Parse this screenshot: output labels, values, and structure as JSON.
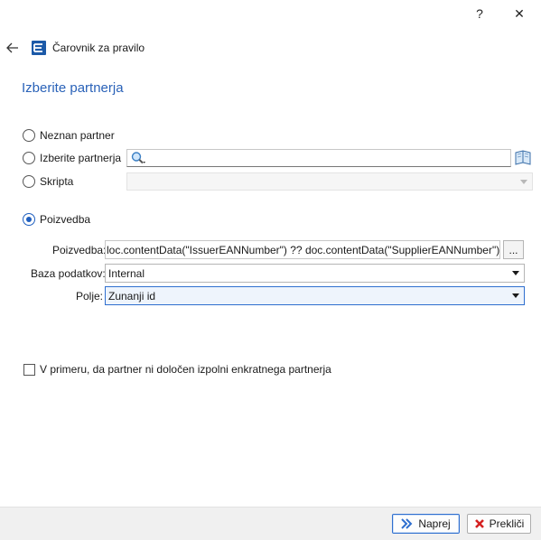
{
  "window": {
    "help_label": "?",
    "close_label": "✕",
    "app_title": "Čarovnik za pravilo",
    "back_icon": "arrow-left-icon",
    "app_icon": "app-logo-icon"
  },
  "page": {
    "title": "Izberite partnerja"
  },
  "options": {
    "unknown_partner": {
      "label": "Neznan partner",
      "checked": false
    },
    "select_partner": {
      "label": "Izberite partnerja",
      "checked": false
    },
    "script": {
      "label": "Skripta",
      "checked": false
    },
    "query": {
      "label": "Poizvedba",
      "checked": true
    }
  },
  "select_partner_field": {
    "value": "",
    "search_icon": "magnifier-icon",
    "browse_icon": "book-icon"
  },
  "script_field": {
    "value": ""
  },
  "query_section": {
    "query_label": "Poizvedba:",
    "query_value": "loc.contentData(\"IssuerEANNumber\") ?? doc.contentData(\"SupplierEANNumber\")}' as from",
    "browse_label": "...",
    "database_label": "Baza podatkov:",
    "database_value": "Internal",
    "field_label": "Polje:",
    "field_value": "Zunanji id"
  },
  "fallback_checkbox": {
    "label": "V primeru, da partner ni določen izpolni enkratnega partnerja",
    "checked": false
  },
  "footer": {
    "next_label": "Naprej",
    "cancel_label": "Prekliči",
    "next_icon": "double-chevron-right-icon",
    "cancel_icon": "red-x-icon"
  },
  "colors": {
    "accent": "#2a62b8",
    "radio_checked": "#1f5fbf",
    "footer_bg": "#f0f0f0"
  }
}
